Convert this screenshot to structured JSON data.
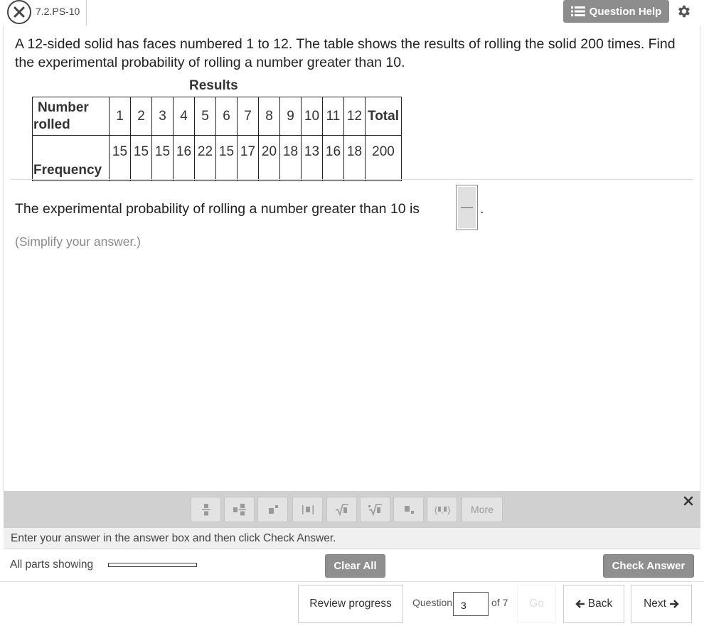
{
  "header": {
    "question_id": "7.2.PS-10",
    "help_label": "Question Help"
  },
  "problem": {
    "text": "A 12-sided solid has faces numbered 1 to 12. The table shows the results of rolling the solid 200 times. Find the experimental probability of rolling a number greater than 10."
  },
  "table": {
    "title": "Results",
    "row1_header_line1": "Number",
    "row1_header_line2": "rolled",
    "row2_header": "Frequency",
    "numbers": [
      "1",
      "2",
      "3",
      "4",
      "5",
      "6",
      "7",
      "8",
      "9",
      "10",
      "11",
      "12"
    ],
    "total_label": "Total",
    "frequencies": [
      "15",
      "15",
      "15",
      "16",
      "22",
      "15",
      "17",
      "20",
      "18",
      "13",
      "16",
      "18"
    ],
    "total": "200"
  },
  "answer": {
    "prompt": "The experimental probability of rolling a number greater than 10 is",
    "suffix": ".",
    "hint": "(Simplify your answer.)"
  },
  "toolbar": {
    "buttons": [
      "fraction",
      "mixed-number",
      "exponent",
      "absolute-value",
      "square-root",
      "nth-root",
      "subscript",
      "ordered-pair"
    ],
    "more_label": "More"
  },
  "footer": {
    "instruction": "Enter your answer in the answer box and then click Check Answer.",
    "parts_label": "All parts showing",
    "clear_all": "Clear All",
    "check_answer": "Check Answer"
  },
  "nav": {
    "review_progress": "Review progress",
    "question_label": "Question",
    "question_number": "3",
    "of_label": "of 7",
    "go_label": "Go",
    "back_label": "Back",
    "next_label": "Next"
  }
}
